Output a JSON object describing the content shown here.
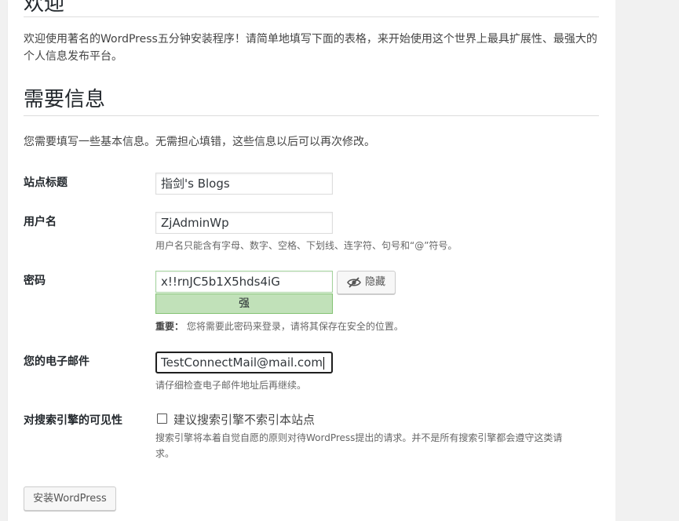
{
  "welcome": {
    "title": "欢迎",
    "intro": "欢迎使用著名的WordPress五分钟安装程序！请简单地填写下面的表格，来开始使用这个世界上最具扩展性、最强大的个人信息发布平台。"
  },
  "info": {
    "title": "需要信息",
    "intro": "您需要填写一些基本信息。无需担心填错，这些信息以后可以再次修改。"
  },
  "form": {
    "site_title": {
      "label": "站点标题",
      "value": "指剑's Blogs"
    },
    "username": {
      "label": "用户名",
      "value": "ZjAdminWp",
      "hint": "用户名只能含有字母、数字、空格、下划线、连字符、句号和“@”符号。"
    },
    "password": {
      "label": "密码",
      "value": "x!!rnJC5b1X5hds4iG",
      "strength": "强",
      "hide_label": "隐藏",
      "hint_strong": "重要：",
      "hint": "您将需要此密码来登录，请将其保存在安全的位置。"
    },
    "email": {
      "label": "您的电子邮件",
      "value": "TestConnectMail@mail.com",
      "hint": "请仔细检查电子邮件地址后再继续。"
    },
    "visibility": {
      "label": "对搜索引擎的可见性",
      "checkbox_label": "建议搜索引擎不索引本站点",
      "checked": false,
      "hint_line1": "搜索引擎将本着自觉自愿的原则对待WordPress提出的请求。并不是所有搜索引擎都会遵守这类请",
      "hint_line2": "求。"
    }
  },
  "install_button": "安装WordPress",
  "icons": {
    "hide": "eye-slash-icon",
    "checkbox": "checkbox-icon"
  }
}
